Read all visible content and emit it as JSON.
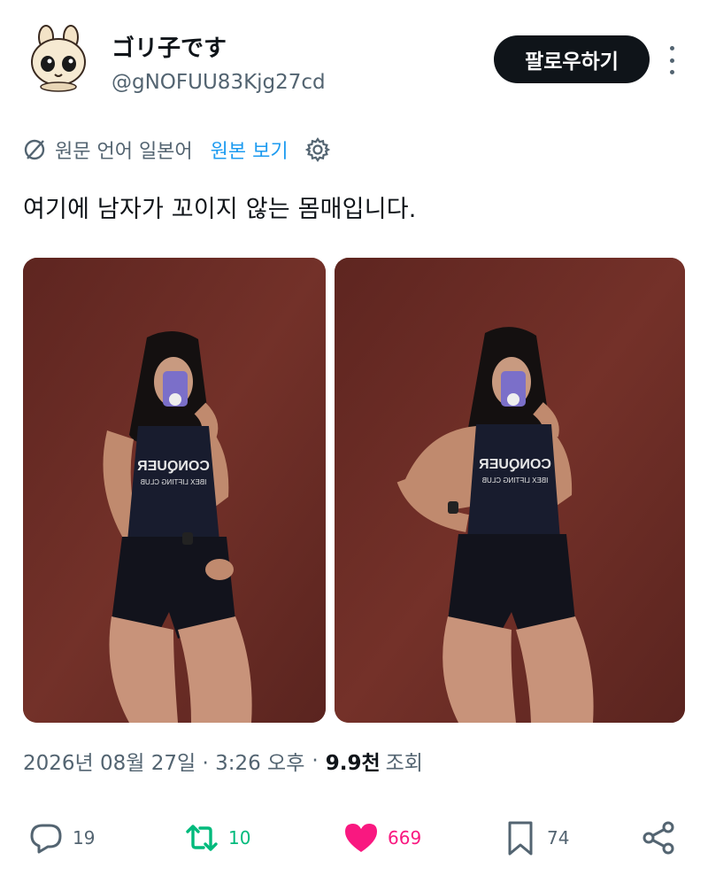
{
  "author": {
    "display_name": "ゴリ子です",
    "handle": "@gNOFUU83Kjg27cd",
    "follow_label": "팔로우하기"
  },
  "translation": {
    "source_language_label": "원문 언어 일본어",
    "show_original_label": "원본 보기"
  },
  "tweet": {
    "text": "여기에 남자가 꼬이지 않는 몸매입니다.",
    "images": [
      {
        "shirt_text_line1": "CONQUER",
        "shirt_text_line2": "IBEX LIFTING CLUB"
      },
      {
        "shirt_text_line1": "CONQUER",
        "shirt_text_line2": "IBEX LIFTING CLUB"
      }
    ]
  },
  "meta": {
    "timestamp": "2026년 08월 27일 · 3:26 오후",
    "separator": "·",
    "views_count": "9.9천",
    "views_label": "조회"
  },
  "actions": {
    "reply_count": "19",
    "repost_count": "10",
    "like_count": "669",
    "bookmark_count": "74"
  },
  "colors": {
    "text_primary": "#0f1419",
    "text_secondary": "#536471",
    "link": "#1d9bf0",
    "repost": "#00ba7c",
    "like": "#f91880",
    "photo_wall": "#6b2b25"
  }
}
